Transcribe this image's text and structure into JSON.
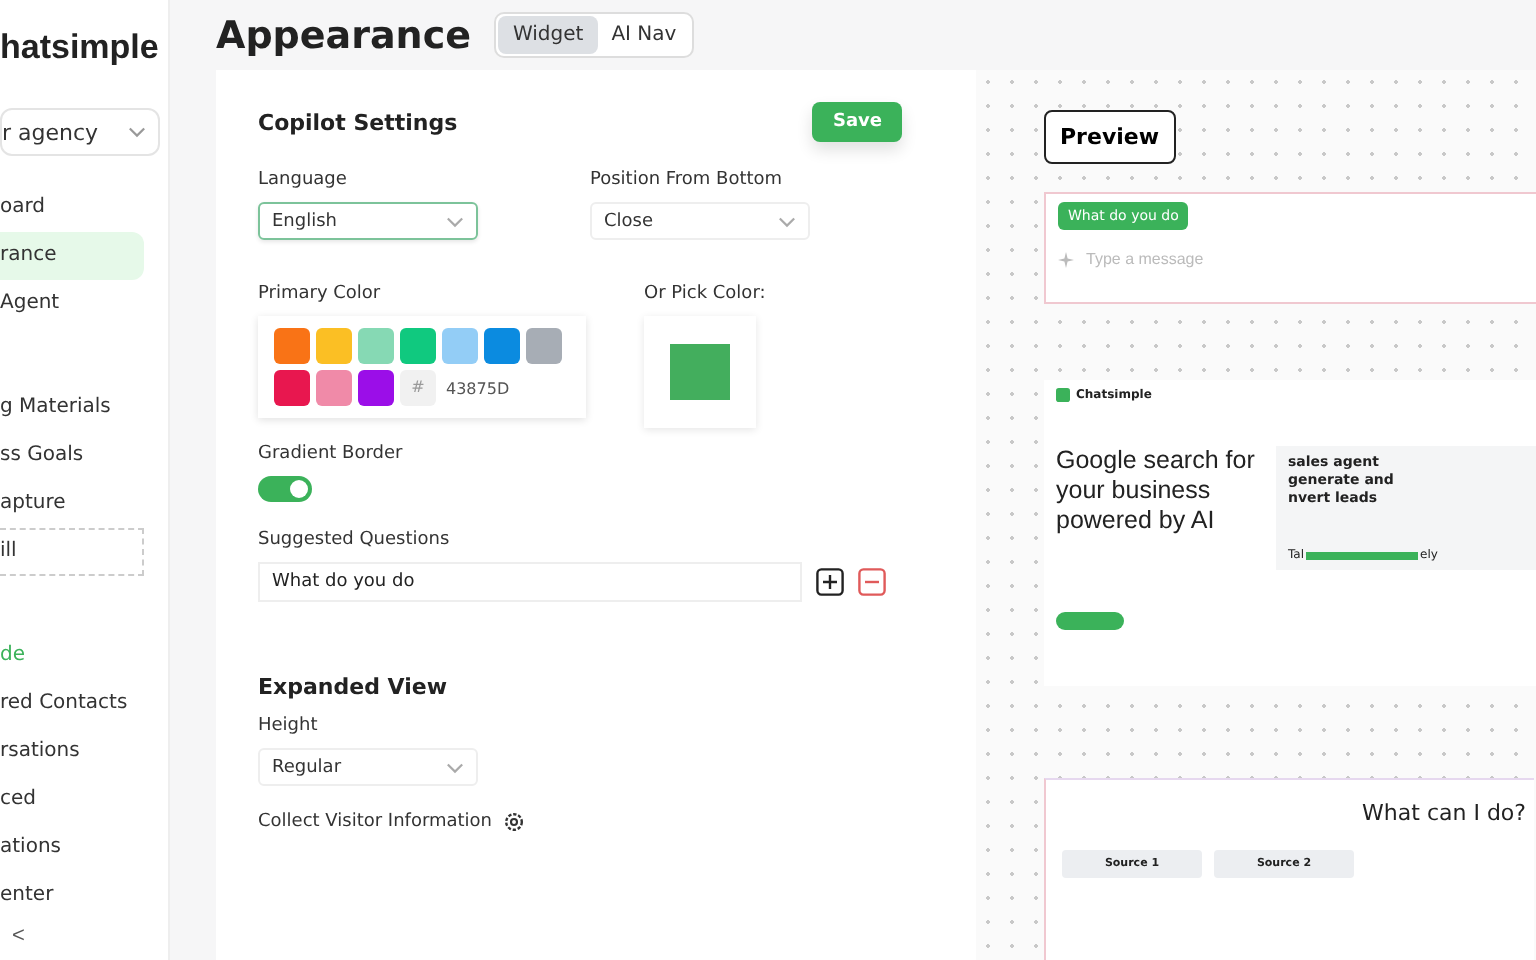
{
  "sidebar": {
    "logo": "hatsimple",
    "workspace": "r agency",
    "sections": [
      {
        "items": [
          {
            "label": "oard",
            "selected": false,
            "kind": "plain"
          },
          {
            "label": "rance",
            "selected": true,
            "kind": "plain"
          },
          {
            "label": "Agent",
            "selected": false,
            "kind": "plain"
          }
        ]
      },
      {
        "items": [
          {
            "label": "g Materials",
            "selected": false,
            "kind": "plain"
          },
          {
            "label": "ss Goals",
            "selected": false,
            "kind": "plain"
          },
          {
            "label": "apture",
            "selected": false,
            "kind": "plain"
          },
          {
            "label": "ill",
            "selected": false,
            "kind": "dashed"
          }
        ]
      },
      {
        "items": [
          {
            "label": "de",
            "selected": false,
            "kind": "accent"
          },
          {
            "label": "red Contacts",
            "selected": false,
            "kind": "plain"
          },
          {
            "label": "rsations",
            "selected": false,
            "kind": "plain"
          },
          {
            "label": "ced",
            "selected": false,
            "kind": "plain"
          },
          {
            "label": "ations",
            "selected": false,
            "kind": "plain"
          },
          {
            "label": "enter",
            "selected": false,
            "kind": "plain"
          }
        ]
      }
    ],
    "collapse": "<"
  },
  "header": {
    "title": "Appearance",
    "tabs": [
      {
        "label": "Widget",
        "selected": true
      },
      {
        "label": "AI Nav",
        "selected": false
      }
    ]
  },
  "settings": {
    "title": "Copilot Settings",
    "save": "Save",
    "language": {
      "label": "Language",
      "value": "English"
    },
    "position": {
      "label": "Position From Bottom",
      "value": "Close"
    },
    "primary_color": {
      "label": "Primary Color",
      "swatches": [
        {
          "color": "#f97316"
        },
        {
          "color": "#fbbf24"
        },
        {
          "color": "#86d9b4"
        },
        {
          "color": "#10c97f"
        },
        {
          "color": "#93cdf6"
        },
        {
          "color": "#0b8be0"
        },
        {
          "color": "#a7adb5"
        },
        {
          "color": "#e8174f"
        },
        {
          "color": "#f08aa8"
        },
        {
          "color": "#9b0ee8"
        }
      ],
      "hash": "#",
      "hex": "43875D"
    },
    "pick_color": {
      "label": "Or Pick Color:",
      "color": "#43ae5d"
    },
    "gradient_border": {
      "label": "Gradient Border",
      "on": true
    },
    "suggested_questions": {
      "label": "Suggested Questions",
      "items": [
        "What do you do"
      ]
    },
    "expanded_view": {
      "title": "Expanded View",
      "height_label": "Height",
      "height_value": "Regular",
      "collect_label": "Collect Visitor Information"
    }
  },
  "preview": {
    "button": "Preview",
    "widget": {
      "chip": "What do you do",
      "placeholder": "Type a message"
    },
    "website": {
      "logo": "Chatsimple",
      "headline": "Google search for your business powered by AI",
      "side_text": "sales agent generate and nvert leads",
      "fragment_left": "Tal",
      "fragment_right": "ely"
    },
    "expanded": {
      "question": "What can I do?",
      "sources": [
        "Source 1",
        "Source 2"
      ]
    }
  }
}
